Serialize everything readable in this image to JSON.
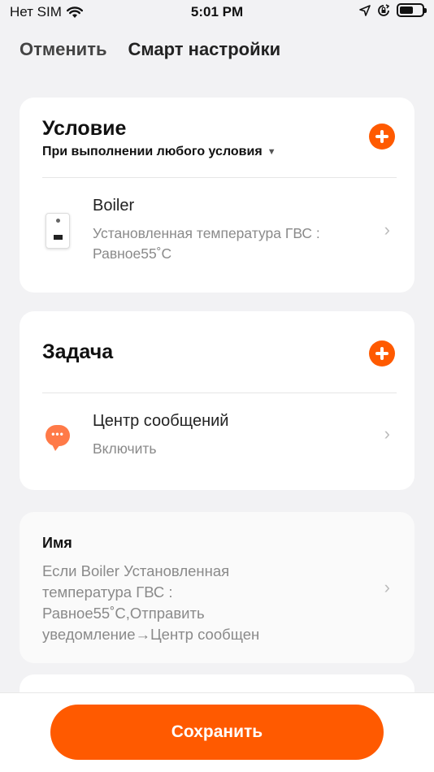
{
  "status_bar": {
    "carrier": "Нет SIM",
    "time": "5:01 PM",
    "icons": [
      "wifi-icon",
      "location-arrow-icon",
      "orientation-lock-icon",
      "battery-icon"
    ],
    "battery_level": 0.6
  },
  "nav": {
    "cancel_label": "Отменить",
    "title": "Смарт настройки"
  },
  "condition": {
    "title": "Условие",
    "type_label": "При выполнении любого условия",
    "item": {
      "title": "Boiler",
      "subtitle_line1": "Установленная температура ГВС :",
      "subtitle_line2": "Равное55˚C"
    }
  },
  "task": {
    "title": "Задача",
    "item": {
      "title": "Центр сообщений",
      "subtitle": "Включить"
    }
  },
  "name": {
    "label": "Имя",
    "line1": "Если Boiler Установленная",
    "line2": "температура ГВС :",
    "line3": "Равное55˚C,Отправить",
    "line4": "уведомление→Центр сообщен"
  },
  "save_label": "Сохранить",
  "colors": {
    "accent": "#ff5a00",
    "background": "#f2f2f4",
    "card": "#ffffff",
    "secondary_text": "#8a8a8a"
  }
}
